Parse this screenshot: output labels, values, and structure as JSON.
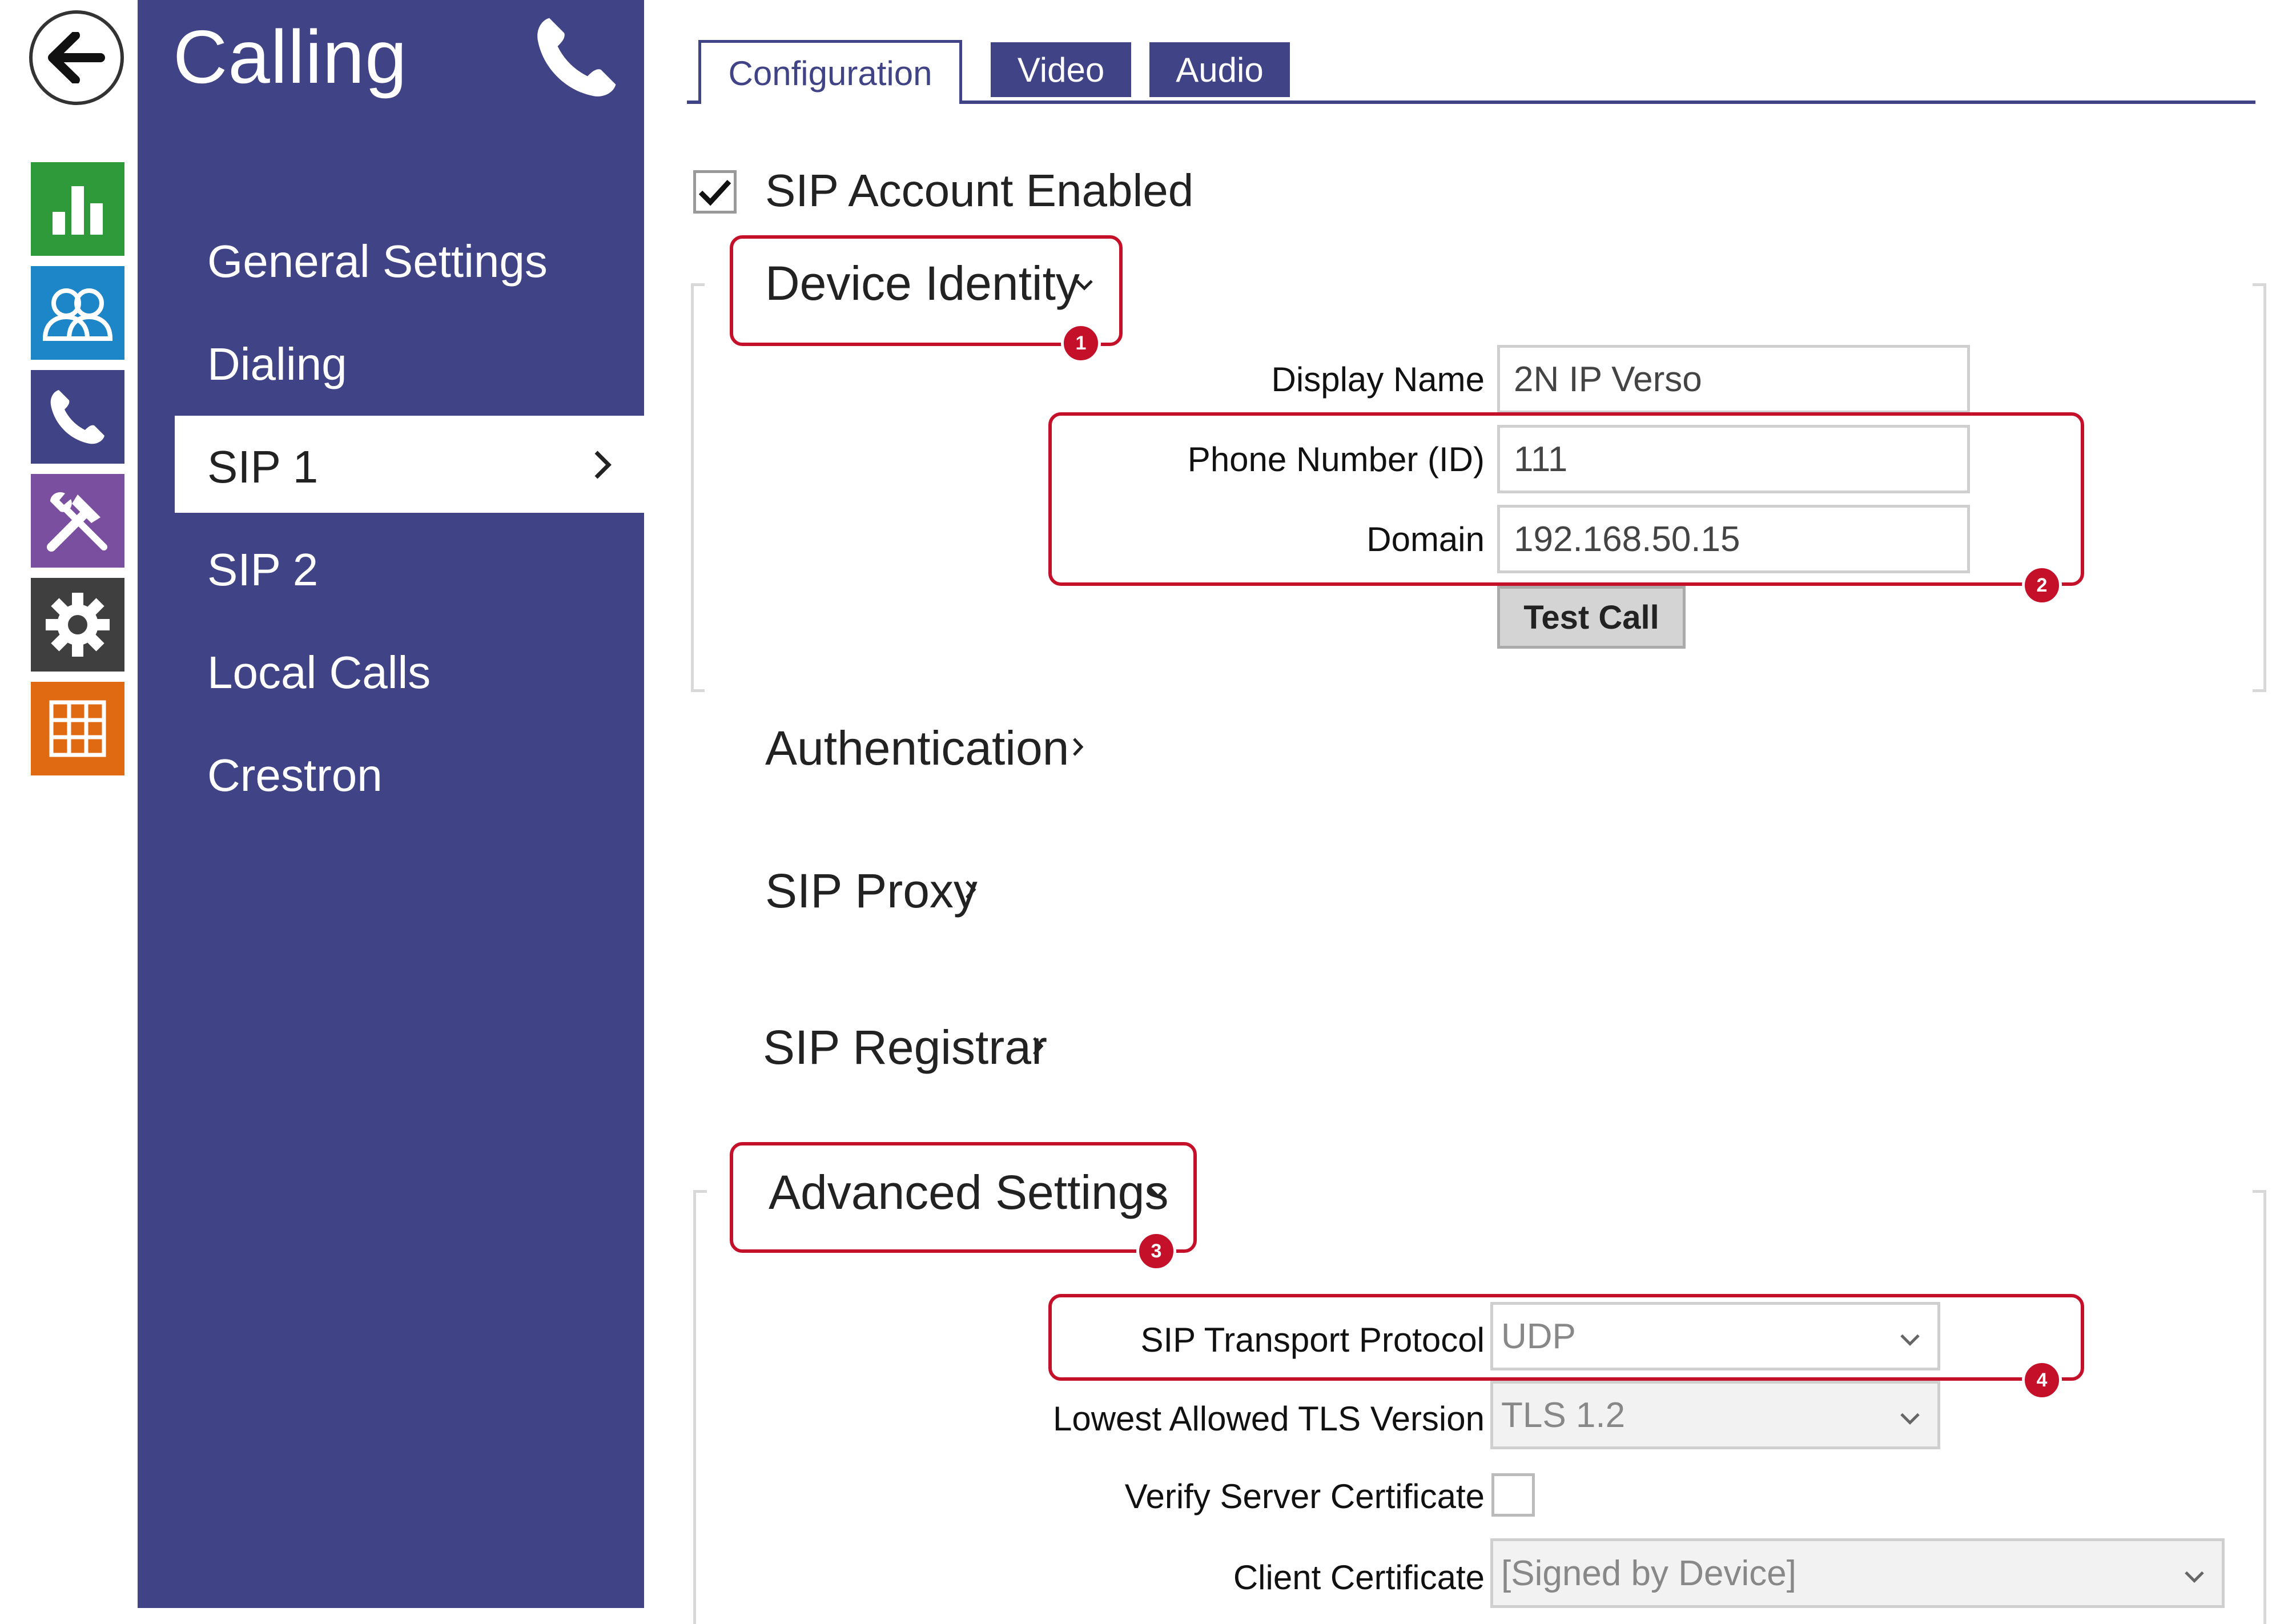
{
  "rail": {
    "back_icon": "arrow-left-icon",
    "items": [
      {
        "icon": "bar-chart-icon",
        "color": "#2e9a3a"
      },
      {
        "icon": "users-icon",
        "color": "#1c86c8"
      },
      {
        "icon": "phone-icon",
        "color": "#404486"
      },
      {
        "icon": "tools-icon",
        "color": "#7a4fa0"
      },
      {
        "icon": "gear-icon",
        "color": "#3f3f3f"
      },
      {
        "icon": "grid-icon",
        "color": "#e06a12"
      }
    ]
  },
  "nav": {
    "title": "Calling",
    "title_icon": "phone-icon",
    "items": [
      {
        "label": "General Settings"
      },
      {
        "label": "Dialing"
      },
      {
        "label": "SIP 1",
        "active": true
      },
      {
        "label": "SIP 2"
      },
      {
        "label": "Local Calls"
      },
      {
        "label": "Crestron"
      }
    ]
  },
  "tabs": [
    {
      "label": "Configuration",
      "active": true
    },
    {
      "label": "Video"
    },
    {
      "label": "Audio"
    }
  ],
  "account": {
    "enabled_label": "SIP Account Enabled",
    "enabled": true
  },
  "device_identity": {
    "heading": "Device Identity",
    "display_name_label": "Display Name",
    "display_name_value": "2N IP Verso",
    "phone_number_label": "Phone Number (ID)",
    "phone_number_value": "111",
    "domain_label": "Domain",
    "domain_value": "192.168.50.15",
    "test_call_label": "Test Call"
  },
  "sections": {
    "authentication": "Authentication",
    "sip_proxy": "SIP Proxy",
    "sip_registrar": "SIP Registrar",
    "advanced": "Advanced Settings"
  },
  "advanced": {
    "transport_label": "SIP Transport Protocol",
    "transport_value": "UDP",
    "tls_label": "Lowest Allowed TLS Version",
    "tls_value": "TLS 1.2",
    "verify_label": "Verify Server Certificate",
    "verify_checked": false,
    "client_cert_label": "Client Certificate",
    "client_cert_value": "[Signed by Device]"
  },
  "callouts": [
    "1",
    "2",
    "3",
    "4"
  ],
  "colors": {
    "brand": "#404486",
    "callout": "#c5102a"
  }
}
